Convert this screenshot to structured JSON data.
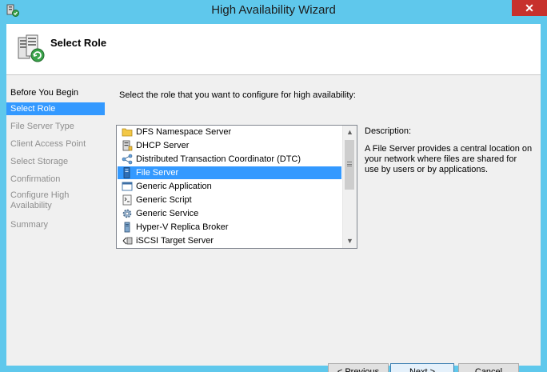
{
  "window": {
    "title": "High Availability Wizard",
    "close_glyph": "✕"
  },
  "header": {
    "title": "Select Role",
    "icon": "server-cluster-wizard-icon"
  },
  "steps": [
    {
      "label": "Before You Begin",
      "state": "done"
    },
    {
      "label": "Select Role",
      "state": "active"
    },
    {
      "label": "File Server Type",
      "state": "pending"
    },
    {
      "label": "Client Access Point",
      "state": "pending"
    },
    {
      "label": "Select Storage",
      "state": "pending"
    },
    {
      "label": "Confirmation",
      "state": "pending"
    },
    {
      "label": "Configure High Availability",
      "state": "pending"
    },
    {
      "label": "Summary",
      "state": "pending"
    }
  ],
  "content": {
    "instruction": "Select the role that you want to configure for high availability:",
    "roles": [
      {
        "label": "DFS Namespace Server",
        "icon": "folder-icon"
      },
      {
        "label": "DHCP Server",
        "icon": "dhcp-icon"
      },
      {
        "label": "Distributed Transaction Coordinator (DTC)",
        "icon": "dtc-icon"
      },
      {
        "label": "File Server",
        "icon": "file-server-icon",
        "selected": true
      },
      {
        "label": "Generic Application",
        "icon": "application-icon"
      },
      {
        "label": "Generic Script",
        "icon": "script-icon"
      },
      {
        "label": "Generic Service",
        "icon": "gear-icon"
      },
      {
        "label": "Hyper-V Replica Broker",
        "icon": "server-tower-icon"
      },
      {
        "label": "iSCSI Target Server",
        "icon": "iscsi-icon"
      }
    ],
    "description_label": "Description:",
    "description_text": "A File Server provides a central location on your network where files are shared for use by users or by applications."
  },
  "buttons": {
    "previous": "< Previous",
    "next": "Next >",
    "cancel": "Cancel"
  },
  "colors": {
    "frame": "#5fc8ec",
    "selection": "#3399ff",
    "close": "#c7312c"
  }
}
